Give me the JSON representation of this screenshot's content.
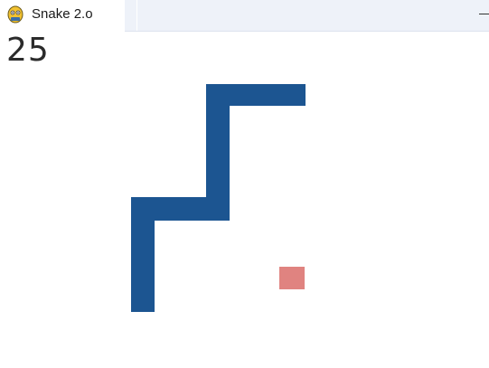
{
  "window": {
    "title": "Snake 2.o",
    "app_icon": "pygame-snake-icon",
    "controls": [
      "minimize-icon"
    ]
  },
  "game": {
    "score": "25",
    "snake_color": "#1c5591",
    "food_color": "#e08380",
    "background_color": "#ffffff"
  }
}
